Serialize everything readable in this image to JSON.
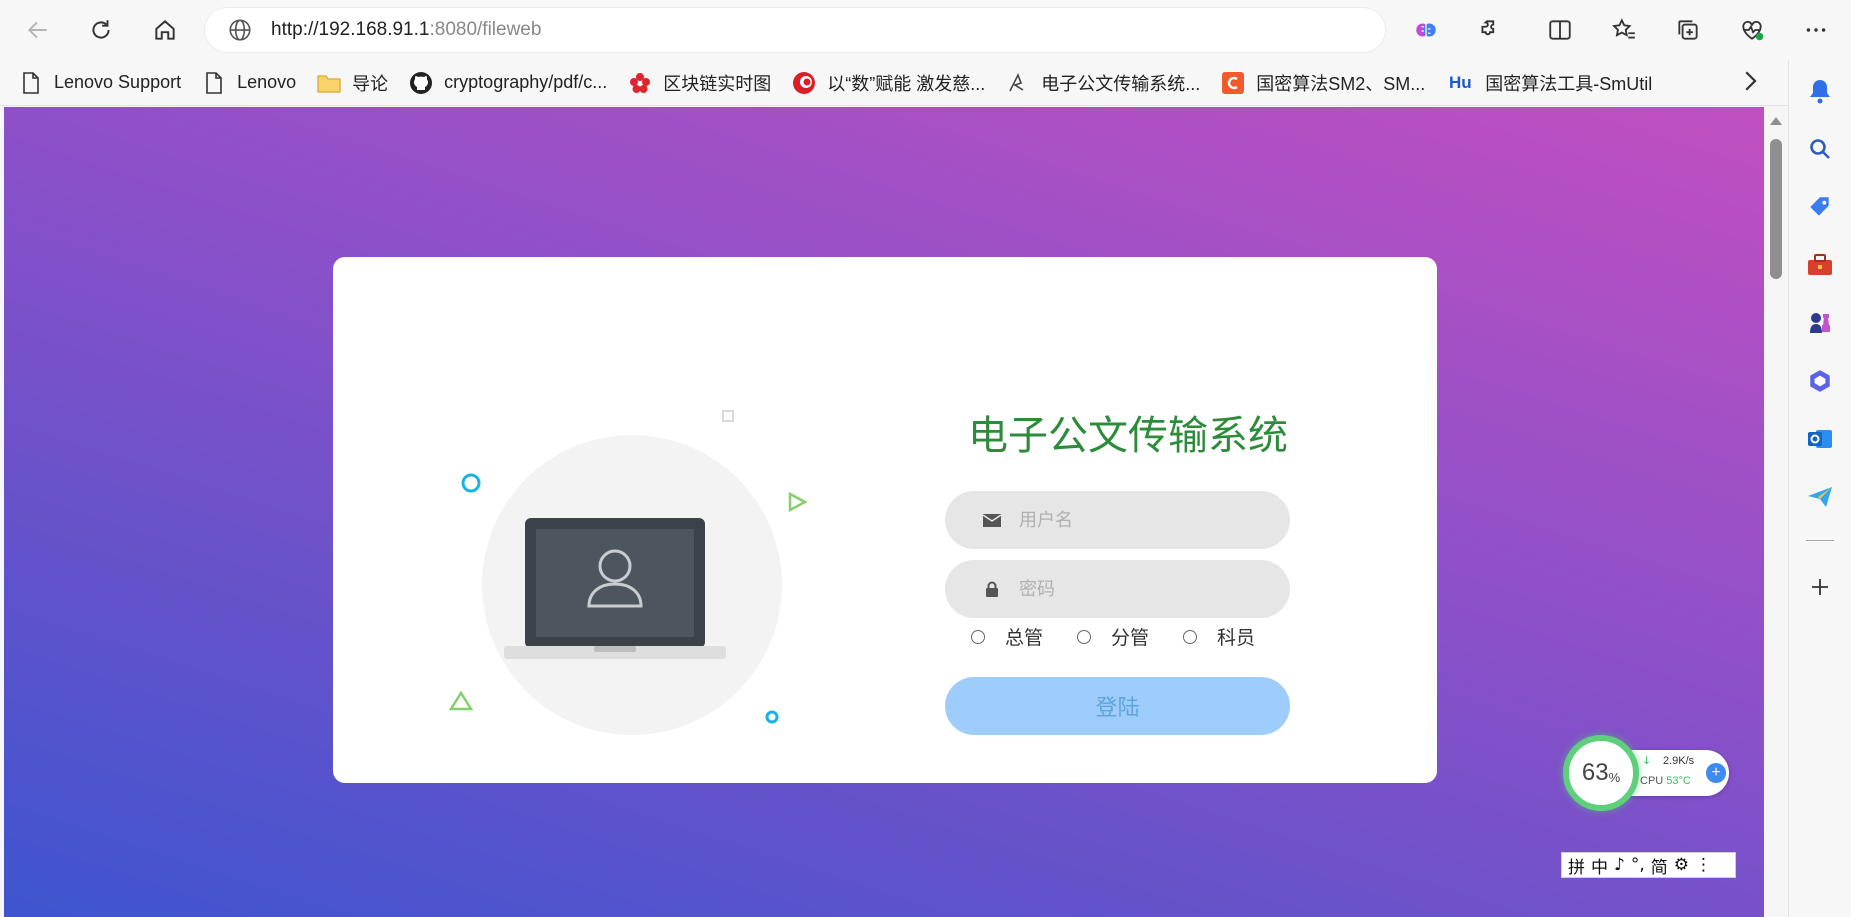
{
  "browser": {
    "url_host": "http://192.168.91.1",
    "url_rest": ":8080/fileweb",
    "bookmarks": [
      {
        "label": "Lenovo Support",
        "icon": "page-icon"
      },
      {
        "label": "Lenovo",
        "icon": "page-icon"
      },
      {
        "label": "导论",
        "icon": "folder-icon"
      },
      {
        "label": "cryptography/pdf/c...",
        "icon": "github-icon"
      },
      {
        "label": "区块链实时图",
        "icon": "flower-icon"
      },
      {
        "label": "以“数”赋能 激发慈...",
        "icon": "red-logo-icon"
      },
      {
        "label": "电子公文传输系统...",
        "icon": "custom-logo-icon"
      },
      {
        "label": "国密算法SM2、SM...",
        "icon": "c-logo-icon"
      },
      {
        "label": "国密算法工具-SmUtil",
        "icon": "hu-logo-icon",
        "badge": "Hu"
      }
    ]
  },
  "login": {
    "title": "电子公文传输系统",
    "username_placeholder": "用户名",
    "password_placeholder": "密码",
    "roles": [
      "总管",
      "分管",
      "科员"
    ],
    "login_label": "登陆"
  },
  "widgets": {
    "cpu_percent": "63",
    "cpu_percent_unit": "%",
    "net_speed": "2.9K/s",
    "cpu_label": "CPU",
    "cpu_temp": "53°C",
    "ime_items": [
      "拼",
      "中",
      "♪",
      "°,",
      "简",
      "⚙",
      "⋮"
    ]
  },
  "colors": {
    "title_green": "#2c8c3a",
    "login_button": "#9fcdfb",
    "gradient_start": "#3d55cf",
    "gradient_end": "#c14fc0"
  }
}
